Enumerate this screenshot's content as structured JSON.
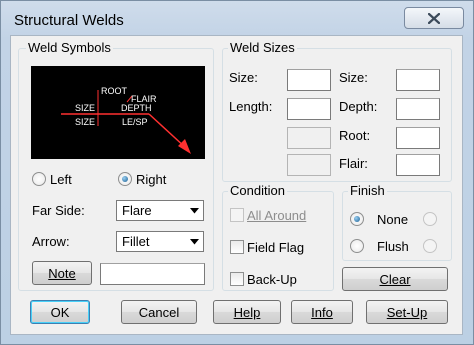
{
  "window": {
    "title": "Structural Welds"
  },
  "weld_symbols": {
    "title": "Weld Symbols",
    "symbol_labels": {
      "root": "ROOT",
      "flair": "FLAIR",
      "depth": "DEPTH",
      "size_top": "SIZE",
      "size_bottom": "SIZE",
      "le_sp": "LE/SP"
    },
    "side_left": "Left",
    "side_right": "Right",
    "far_side_label": "Far Side:",
    "far_side_value": "Flare",
    "arrow_label": "Arrow:",
    "arrow_value": "Fillet",
    "note_button": "Note",
    "note_value": ""
  },
  "weld_sizes": {
    "title": "Weld Sizes",
    "left_labels": [
      "Size:",
      "Length:"
    ],
    "right_labels": [
      "Size:",
      "Depth:",
      "Root:",
      "Flair:"
    ]
  },
  "condition": {
    "title": "Condition",
    "all_around": "All Around",
    "field_flag": "Field Flag",
    "back_up": "Back-Up"
  },
  "finish": {
    "title": "Finish",
    "none": "None",
    "flush": "Flush"
  },
  "buttons": {
    "clear": "Clear",
    "ok": "OK",
    "cancel": "Cancel",
    "help": "Help",
    "info": "Info",
    "setup": "Set-Up"
  },
  "colors": {
    "symbol_bg": "#000000",
    "weld_line": "#ff3030",
    "symbol_text": "#ffffff",
    "accent_radio": "#1b5f93"
  },
  "icons": {
    "close": "close-icon",
    "dropdown": "chevron-down-icon"
  }
}
